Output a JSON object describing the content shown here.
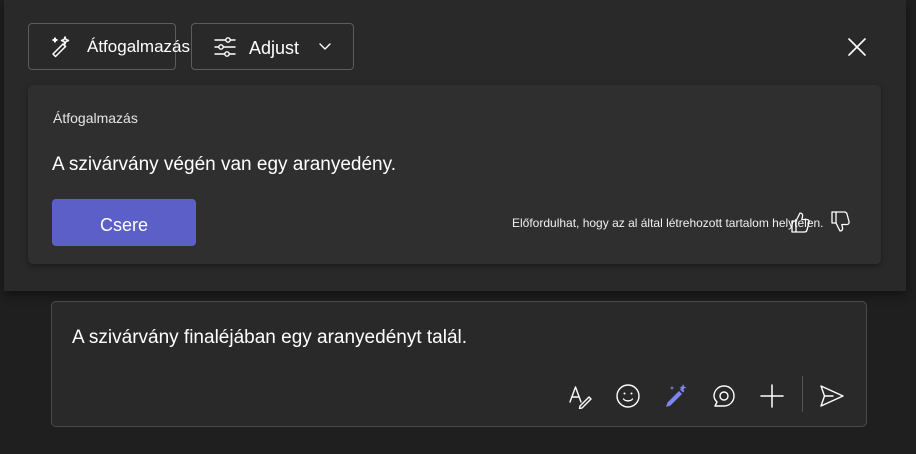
{
  "toolbar": {
    "rewrite_label": "Átfogalmazás",
    "adjust_label": "Adjust"
  },
  "result": {
    "heading": "Átfogalmazás",
    "text": "A szivárvány végén van egy aranyedény.",
    "replace_label": "Csere",
    "disclaimer": "Előfordulhat, hogy az al által létrehozott tartalom helytelen."
  },
  "compose": {
    "text": "A szivárvány finaléjában egy aranyedényt talál."
  },
  "colors": {
    "accent": "#5b5fc7",
    "copilot_icon": "#7f85f5",
    "panel_bg": "#292929",
    "card_bg": "#2f2f2f",
    "page_bg": "#1f1f1f"
  },
  "icons": {
    "rewrite": "sparkle-pen-icon",
    "adjust": "sliders-icon",
    "adjust_chevron": "chevron-down-icon",
    "close": "close-icon",
    "thumb_up": "thumbs-up-icon",
    "thumb_down": "thumbs-down-icon",
    "format": "format-text-icon",
    "emoji": "emoji-icon",
    "copilot": "copilot-rewrite-icon",
    "loop": "loop-icon",
    "attach": "plus-icon",
    "send": "send-icon"
  }
}
